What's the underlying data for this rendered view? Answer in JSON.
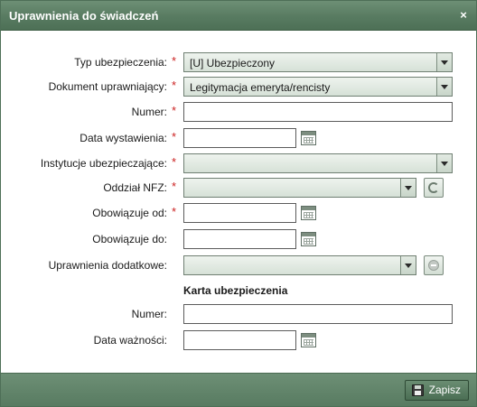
{
  "dialog": {
    "title": "Uprawnienia do świadczeń",
    "close_symbol": "×"
  },
  "form": {
    "required_marker": "*",
    "fields": {
      "typ_ubezpieczenia": {
        "label": "Typ ubezpieczenia:",
        "value": "[U] Ubezpieczony"
      },
      "dokument": {
        "label": "Dokument uprawniający:",
        "value": "Legitymacja emeryta/rencisty"
      },
      "numer": {
        "label": "Numer:",
        "value": ""
      },
      "data_wystawienia": {
        "label": "Data wystawienia:",
        "value": ""
      },
      "instytucje": {
        "label": "Instytucje ubezpieczające:",
        "value": ""
      },
      "oddzial_nfz": {
        "label": "Oddział NFZ:",
        "value": ""
      },
      "obowiazuje_od": {
        "label": "Obowiązuje od:",
        "value": ""
      },
      "obowiazuje_do": {
        "label": "Obowiązuje do:",
        "value": ""
      },
      "uprawnienia_dodatkowe": {
        "label": "Uprawnienia dodatkowe:",
        "value": ""
      }
    },
    "karta": {
      "heading": "Karta ubezpieczenia",
      "numer": {
        "label": "Numer:",
        "value": ""
      },
      "data_waznosci": {
        "label": "Data ważności:",
        "value": ""
      }
    }
  },
  "footer": {
    "save_label": "Zapisz"
  },
  "colors": {
    "titlebar": "#587b61",
    "required": "#cc2222"
  }
}
